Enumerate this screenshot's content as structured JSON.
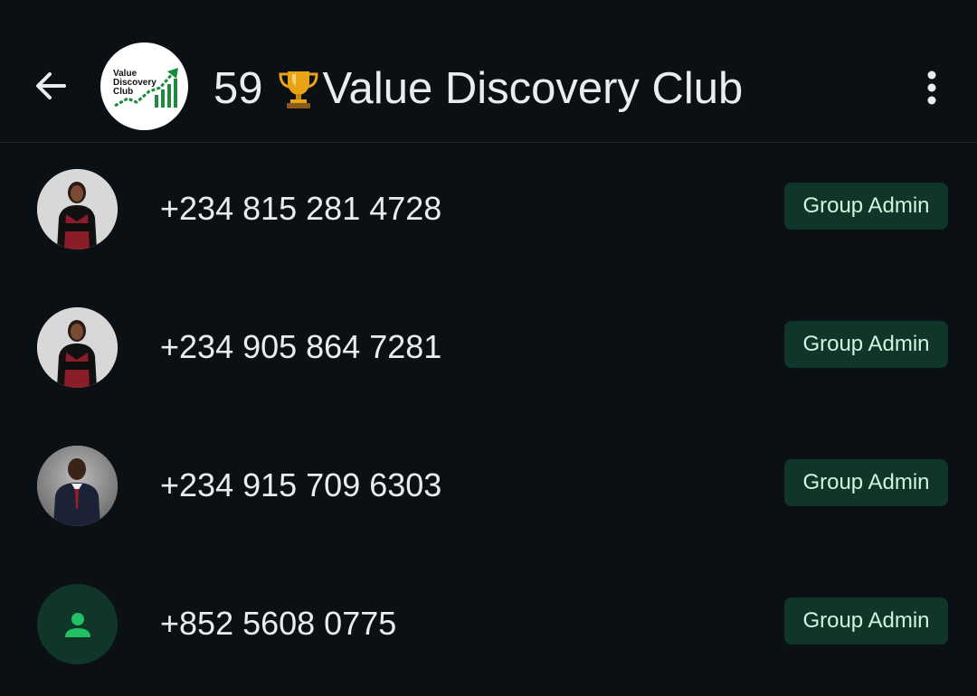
{
  "header": {
    "back_icon": "arrow-left-icon",
    "group_logo_lines": [
      "Value",
      "Discovery",
      "Club"
    ],
    "member_count": "59",
    "trophy_icon": "trophy-emoji",
    "group_name": "Value Discovery Club",
    "menu_icon": "more-vertical-icon"
  },
  "members": [
    {
      "phone": "+234 815 281 4728",
      "role": "Group Admin",
      "avatar": "photo-woman-red-vest"
    },
    {
      "phone": "+234 905 864 7281",
      "role": "Group Admin",
      "avatar": "photo-woman-red-vest"
    },
    {
      "phone": "+234 915 709 6303",
      "role": "Group Admin",
      "avatar": "photo-man-suit"
    },
    {
      "phone": "+852 5608 0775",
      "role": "Group Admin",
      "avatar": "default-person-icon"
    }
  ],
  "colors": {
    "background": "#0b1014",
    "text": "#e9edef",
    "badge_bg": "#103529",
    "badge_text": "#d0f5dd",
    "accent_green": "#21c063"
  }
}
